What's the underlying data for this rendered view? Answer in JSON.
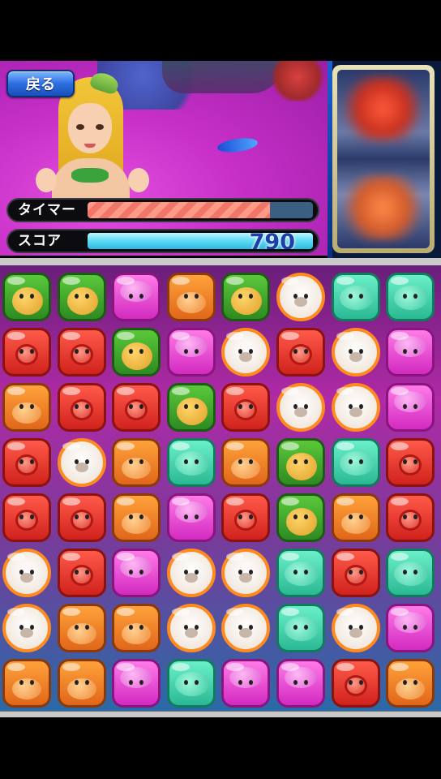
{
  "header": {
    "back_label": "戻る"
  },
  "hud": {
    "timer_label": "タイマー",
    "timer_fraction": 0.81,
    "score_label": "スコア",
    "score_value": "790"
  },
  "board": {
    "columns": 8,
    "rows": 8,
    "tiles": [
      [
        "turtle",
        "turtle",
        "squid",
        "crab",
        "turtle",
        "seal",
        "fish",
        "fish"
      ],
      [
        "octopus",
        "octopus",
        "turtle",
        "squid",
        "seal",
        "octopus",
        "seal",
        "squid"
      ],
      [
        "crab",
        "octopus",
        "octopus",
        "turtle",
        "octopus",
        "seal",
        "seal",
        "squid"
      ],
      [
        "octopus",
        "seal",
        "crab",
        "fish",
        "crab",
        "turtle",
        "fish",
        "octopus"
      ],
      [
        "octopus",
        "octopus",
        "crab",
        "squid",
        "octopus",
        "turtle",
        "crab",
        "octopus"
      ],
      [
        "seal",
        "octopus",
        "squid",
        "seal",
        "seal",
        "fish",
        "octopus",
        "fish"
      ],
      [
        "seal",
        "crab",
        "crab",
        "seal",
        "seal",
        "fish",
        "seal",
        "squid"
      ],
      [
        "crab",
        "crab",
        "squid",
        "fish",
        "squid",
        "squid",
        "octopus",
        "crab"
      ]
    ]
  },
  "colors": {
    "timer_fill": "#f07668",
    "score_fill": "#62dcf5",
    "back_button": "#2d6fe0"
  }
}
